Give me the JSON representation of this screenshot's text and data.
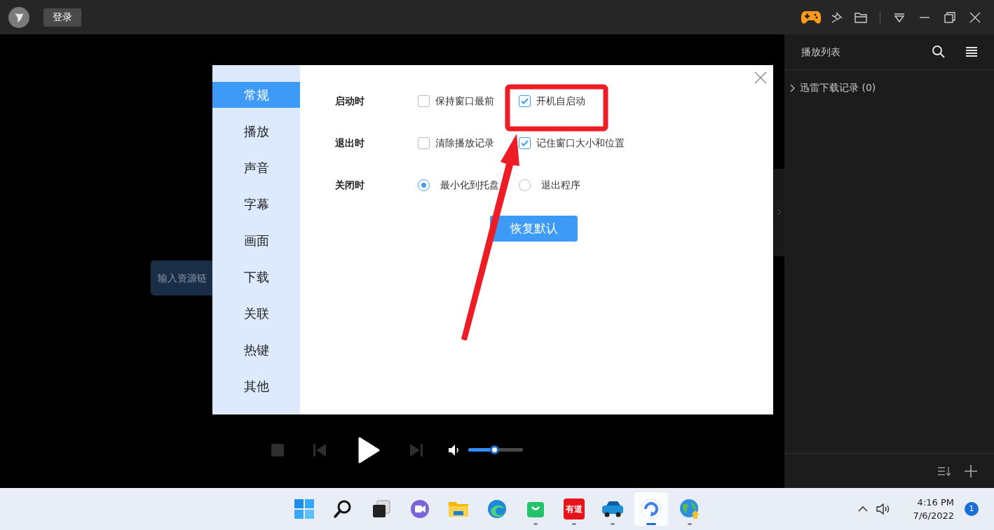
{
  "title_bar": {
    "login_button": "登录"
  },
  "input": {
    "placeholder": "输入资源链"
  },
  "dialog": {
    "nav": [
      {
        "label": "常规",
        "selected": true
      },
      {
        "label": "播放",
        "selected": false
      },
      {
        "label": "声音",
        "selected": false
      },
      {
        "label": "字幕",
        "selected": false
      },
      {
        "label": "画面",
        "selected": false
      },
      {
        "label": "下载",
        "selected": false
      },
      {
        "label": "关联",
        "selected": false
      },
      {
        "label": "热键",
        "selected": false
      },
      {
        "label": "其他",
        "selected": false
      }
    ],
    "rows": [
      {
        "label": "启动时",
        "options": [
          {
            "kind": "checkbox",
            "label": "保持窗口最前",
            "checked": false
          },
          {
            "kind": "checkbox",
            "label": "开机自启动",
            "checked": true
          }
        ]
      },
      {
        "label": "退出时",
        "options": [
          {
            "kind": "checkbox",
            "label": "清除播放记录",
            "checked": false
          },
          {
            "kind": "checkbox",
            "label": "记住窗口大小和位置",
            "checked": true
          }
        ]
      },
      {
        "label": "关闭时",
        "options": [
          {
            "kind": "radio",
            "label": "最小化到托盘",
            "selected": true
          },
          {
            "kind": "radio",
            "label": "退出程序",
            "selected": false
          }
        ]
      }
    ],
    "reset_button": "恢复默认"
  },
  "player": {
    "volume": {
      "level": 0.48
    }
  },
  "playlist": {
    "title": "播放列表",
    "groups": [
      {
        "label": "迅雷下载记录 (0)",
        "expanded": false
      }
    ]
  },
  "taskbar": {
    "apps": [
      {
        "kind": "start",
        "running": false,
        "selected": false
      },
      {
        "kind": "search",
        "running": false,
        "selected": false
      },
      {
        "kind": "task-view",
        "running": false,
        "selected": false
      },
      {
        "kind": "chat",
        "running": false,
        "selected": false
      },
      {
        "kind": "folder",
        "running": false,
        "selected": false
      },
      {
        "kind": "browser",
        "running": false,
        "selected": false
      },
      {
        "kind": "bag",
        "running": true,
        "selected": false
      },
      {
        "kind": "dictionary",
        "label": "有道",
        "running": true,
        "selected": false
      },
      {
        "kind": "car",
        "running": true,
        "selected": false
      },
      {
        "kind": "player",
        "running": true,
        "selected": true
      },
      {
        "kind": "globe",
        "running": true,
        "selected": false
      }
    ],
    "time": "4:16 PM",
    "date": "7/6/2022",
    "badge": "1"
  }
}
